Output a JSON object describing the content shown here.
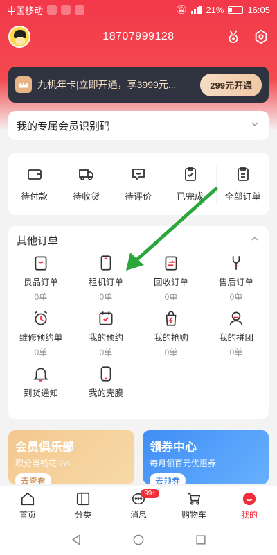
{
  "status": {
    "carrier": "中国移动",
    "battery": "21%",
    "time": "16:05"
  },
  "header": {
    "phone": "18707999128"
  },
  "vip": {
    "text": "九机年卡|立即开通，享3999元...",
    "button": "299元开通"
  },
  "id_card": {
    "label": "我的专属会员识别码"
  },
  "orders": [
    {
      "label": "待付款",
      "icon": "wallet-icon"
    },
    {
      "label": "待收货",
      "icon": "truck-icon"
    },
    {
      "label": "待评价",
      "icon": "comment-icon"
    },
    {
      "label": "已完成",
      "icon": "clipboard-check-icon"
    },
    {
      "label": "全部订单",
      "icon": "list-icon"
    }
  ],
  "other_orders": {
    "title": "其他订单",
    "items": [
      {
        "label": "良品订单",
        "count": "0单",
        "icon": "smile-bag-icon"
      },
      {
        "label": "租机订单",
        "count": "0单",
        "icon": "phone-icon"
      },
      {
        "label": "回收订单",
        "count": "0单",
        "icon": "recycle-clipboard-icon"
      },
      {
        "label": "售后订单",
        "count": "0单",
        "icon": "wrench-icon"
      },
      {
        "label": "维修预约单",
        "count": "0单",
        "icon": "alarm-clock-icon"
      },
      {
        "label": "我的预约",
        "count": "0单",
        "icon": "calendar-check-icon"
      },
      {
        "label": "我的抢购",
        "count": "0单",
        "icon": "flash-bag-icon"
      },
      {
        "label": "我的拼团",
        "count": "0单",
        "icon": "group-icon"
      },
      {
        "label": "到货通知",
        "count": "",
        "icon": "bell-icon"
      },
      {
        "label": "我的壳膜",
        "count": "",
        "icon": "case-icon"
      }
    ]
  },
  "promos": {
    "left": {
      "title": "会员俱乐部",
      "subtitle": "积分当钱花 Go",
      "button": "去查看"
    },
    "right": {
      "title": "领券中心",
      "subtitle": "每月领百元优惠券",
      "button": "去领券"
    }
  },
  "bottom_nav": [
    {
      "label": "首页",
      "icon": "home-icon"
    },
    {
      "label": "分类",
      "icon": "category-icon"
    },
    {
      "label": "消息",
      "icon": "message-icon",
      "badge": "99+"
    },
    {
      "label": "购物车",
      "icon": "cart-icon"
    },
    {
      "label": "我的",
      "icon": "profile-icon",
      "active": true
    }
  ],
  "colors": {
    "brand_red": "#f02e3a",
    "vip_dark": "#2f3340",
    "annotation_green": "#2aa63a"
  }
}
